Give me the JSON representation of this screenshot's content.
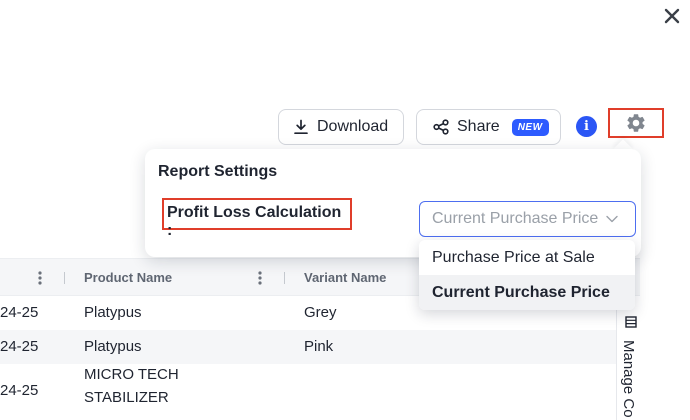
{
  "icons": {
    "close": "close-icon",
    "download": "download-icon",
    "share": "share-icon",
    "info": "info-icon",
    "settings": "gear-icon",
    "column_menu": "kebab-icon",
    "chevron": "chevron-down-icon",
    "manage_columns": "columns-icon"
  },
  "colors": {
    "accent": "#2b56f5",
    "highlight": "#e03e2a",
    "row_alt": "#f5f6f8"
  },
  "toolbar": {
    "download_label": "Download",
    "share_label": "Share",
    "share_badge": "NEW",
    "info_glyph": "i"
  },
  "report_settings": {
    "title": "Report Settings",
    "profit_loss_label": "Profit Loss Calculation :",
    "selected_value": "Current Purchase Price",
    "options": [
      "Purchase Price at Sale",
      "Current Purchase Price"
    ]
  },
  "table": {
    "columns": [
      "Product Name",
      "Variant Name"
    ],
    "rows": [
      {
        "date": "24-25",
        "product": "Platypus",
        "variant": "Grey"
      },
      {
        "date": "24-25",
        "product": "Platypus",
        "variant": "Pink"
      },
      {
        "date": "24-25",
        "product_line1": "MICRO TECH",
        "product_line2": "STABILIZER",
        "variant": ""
      }
    ]
  },
  "manage_columns_label": "Manage Co"
}
